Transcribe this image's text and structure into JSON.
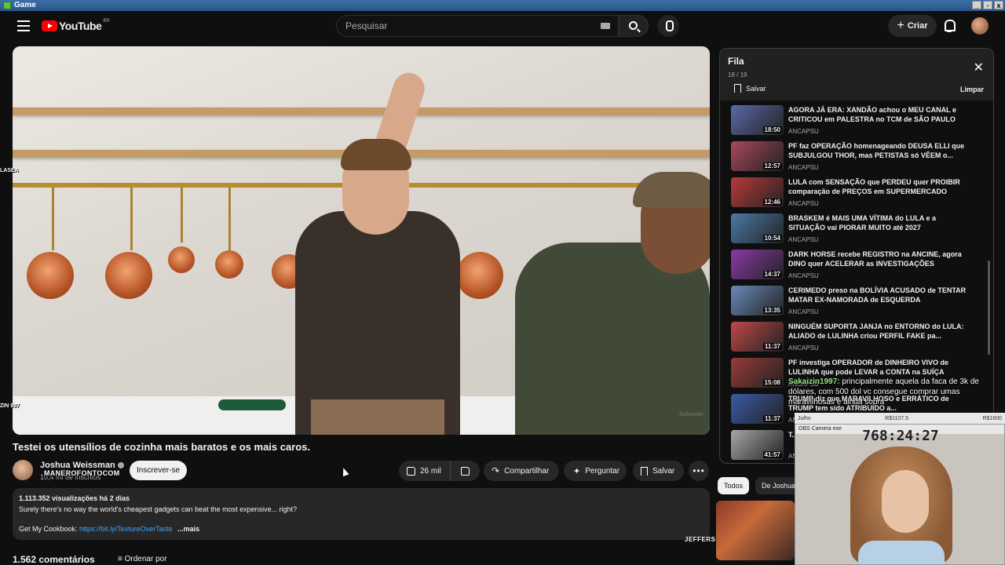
{
  "window": {
    "title": "Game",
    "buttons": [
      "_",
      "▫",
      "x"
    ]
  },
  "header": {
    "logo_text": "YouTube",
    "logo_country": "BR",
    "search_placeholder": "Pesquisar",
    "create_label": "Criar",
    "create_icon": "plus-icon"
  },
  "video": {
    "title": "Testei os utensílios de cozinha mais baratos e os mais caros.",
    "watermark": "Subscribe"
  },
  "channel": {
    "name": "Joshua Weissman",
    "subscribers": "10,4 mi de inscritos",
    "overlay_text": "MANEROFONTOCOM",
    "subscribe_label": "Inscrever-se"
  },
  "actions": {
    "likes": "26 mil",
    "share": "Compartilhar",
    "ask": "Perguntar",
    "save": "Salvar"
  },
  "description": {
    "stats": "1.113.352 visualizações  há 2 dias",
    "line1": "Surely there's no way the world's cheapest gadgets can beat the most expensive... right?",
    "line2_prefix": "Get My Cookbook:",
    "link": "https://bit.ly/TextureOverTaste",
    "more": "...mais"
  },
  "comments": {
    "count": "1.562 comentários",
    "sort": "Ordenar por"
  },
  "queue": {
    "title": "Fila",
    "position": "18 / 19",
    "save": "Salvar",
    "clear": "Limpar",
    "items": [
      {
        "title": "AGORA JÁ ERA: XANDÃO achou o MEU CANAL e CRITICOU em PALESTRA no TCM de SÃO PAULO",
        "channel": "ANCAPSU",
        "duration": "18:50",
        "color": "#5a6aa8"
      },
      {
        "title": "PF faz OPERAÇÃO homenageando DEUSA ELLI que SUBJULGOU THOR, mas PETISTAS só VÊEM o...",
        "channel": "ANCAPSU",
        "duration": "12:57",
        "color": "#a8485a"
      },
      {
        "title": "LULA com SENSAÇÃO que PERDEU quer PROIBIR comparação de PREÇOS em SUPERMERCADO",
        "channel": "ANCAPSU",
        "duration": "12:46",
        "color": "#b83a3a"
      },
      {
        "title": "BRASKEM é MAIS UMA VÍTIMA do LULA e a SITUAÇÃO vai PIORAR MUITO até 2027",
        "channel": "ANCAPSU",
        "duration": "10:54",
        "color": "#4a7aa8"
      },
      {
        "title": "DARK HORSE recebe REGISTRO na ANCINE, agora DINO quer ACELERAR as INVESTIGAÇÕES",
        "channel": "ANCAPSU",
        "duration": "14:37",
        "color": "#8a3aa8"
      },
      {
        "title": "CERIMEDO preso na BOLÍVIA ACUSADO de TENTAR MATAR EX-NAMORADA de ESQUERDA",
        "channel": "ANCAPSU",
        "duration": "13:35",
        "color": "#6a8ab8"
      },
      {
        "title": "NINGUÉM SUPORTA JANJA no ENTORNO do LULA: ALIADO de LULINHA criou PERFIL FAKE pa...",
        "channel": "ANCAPSU",
        "duration": "11:37",
        "color": "#c04848"
      },
      {
        "title": "PF investiga OPERADOR de DINHEIRO VIVO de LULINHA que pode LEVAR a CONTA na SUÍÇA",
        "channel": "ANCAPSU",
        "duration": "15:08",
        "color": "#9a3a3a"
      },
      {
        "title": "TRUMP diz que MARAVILHOSO e ERRÁTICO de TRUMP tem sido ATRIBUÍDO a...",
        "channel": "ANCAPSU",
        "duration": "11:37",
        "color": "#3a5aa8"
      },
      {
        "title": "T...",
        "channel": "ANCAPSU",
        "duration": "41:57",
        "color": "#a8a8a8"
      }
    ]
  },
  "chips": [
    "Todos",
    "De Joshua"
  ],
  "overlays": {
    "chat_user": "Sakaizin1997:",
    "chat_msg": "principalmente aquela da faca de 3k de dólares, com 500 dol vc consegue comprar umas maravilhosas e ainda sobra",
    "left_tag1": "LASEA",
    "left_tag2": "ZIN 997",
    "streamer": "JEFFERSON GREIAS",
    "stream_bar_left": "Julho",
    "stream_bar_mid": "R$1107.5",
    "stream_bar_right": "R$1600",
    "camera_title": "OBS Camera exe",
    "timer": "768:24:27"
  },
  "colors": {
    "accent": "#ff0000",
    "link": "#3ea6ff",
    "bg": "#0f0f0f"
  }
}
